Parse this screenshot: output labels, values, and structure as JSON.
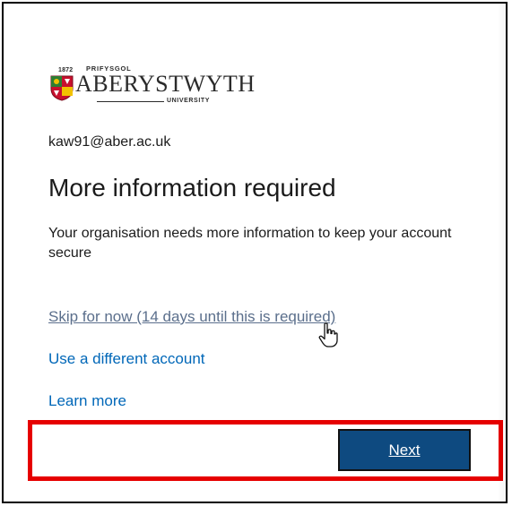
{
  "logo": {
    "year": "1872",
    "prifysgol": "PRIFYSGOL",
    "name": "ABERYSTWYTH",
    "university": "UNIVERSITY"
  },
  "account": {
    "email": "kaw91@aber.ac.uk"
  },
  "heading": "More information required",
  "description": "Your organisation needs more information to keep your account secure",
  "links": {
    "skip": "Skip for now (14 days until this is required)",
    "different_account": "Use a different account",
    "learn_more": "Learn more"
  },
  "buttons": {
    "next": "Next"
  },
  "colors": {
    "link": "#0067b8",
    "button_bg": "#0e4a80",
    "highlight": "#e60000"
  },
  "icons": {
    "cursor": "hand-pointer-icon",
    "crest": "university-crest-icon"
  }
}
